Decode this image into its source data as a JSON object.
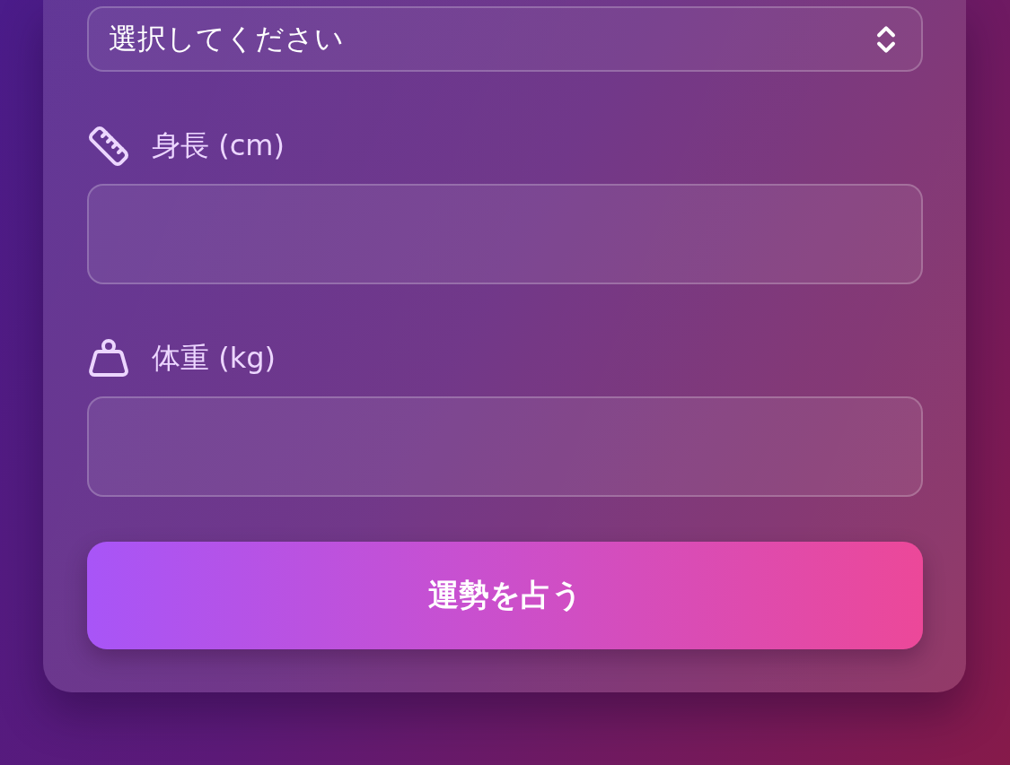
{
  "form": {
    "select": {
      "value": "選択してください"
    },
    "height_field": {
      "label": "身長 (cm)"
    },
    "weight_field": {
      "label": "体重 (kg)"
    },
    "submit_button": {
      "label": "運勢を占う"
    }
  }
}
